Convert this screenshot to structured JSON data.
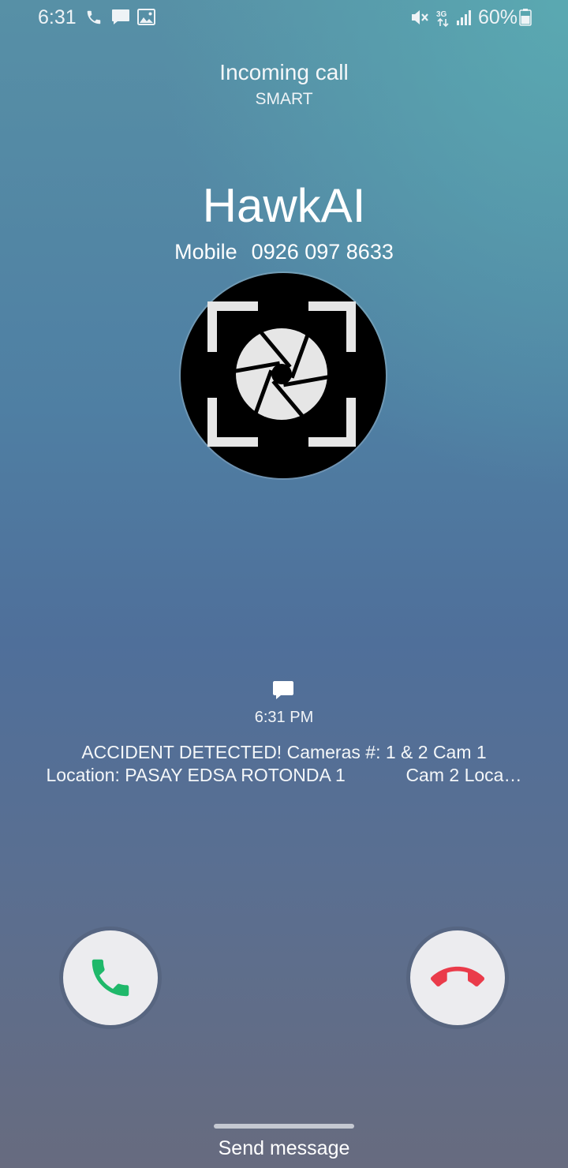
{
  "status_bar": {
    "time": "6:31",
    "battery": "60%",
    "network": "3G",
    "icons": [
      "phone-icon",
      "message-icon",
      "gallery-icon",
      "mute-icon",
      "network-3g-icon",
      "signal-icon",
      "battery-icon"
    ]
  },
  "call": {
    "status": "Incoming call",
    "carrier": "SMART",
    "caller_name": "HawkAI",
    "number_type": "Mobile",
    "number": "0926 097 8633",
    "avatar_icon": "camera-aperture-logo"
  },
  "message_preview": {
    "icon": "message-icon",
    "time": "6:31 PM",
    "line1": "ACCIDENT DETECTED! Cameras #: 1 & 2 Cam 1",
    "line2": "Location: PASAY EDSA ROTONDA 1            Cam 2 Loca…"
  },
  "actions": {
    "accept_icon": "phone-icon",
    "decline_icon": "phone-hangup-icon",
    "accept_color": "#1fb86a",
    "decline_color": "#ea3b4a",
    "send_message": "Send message"
  }
}
